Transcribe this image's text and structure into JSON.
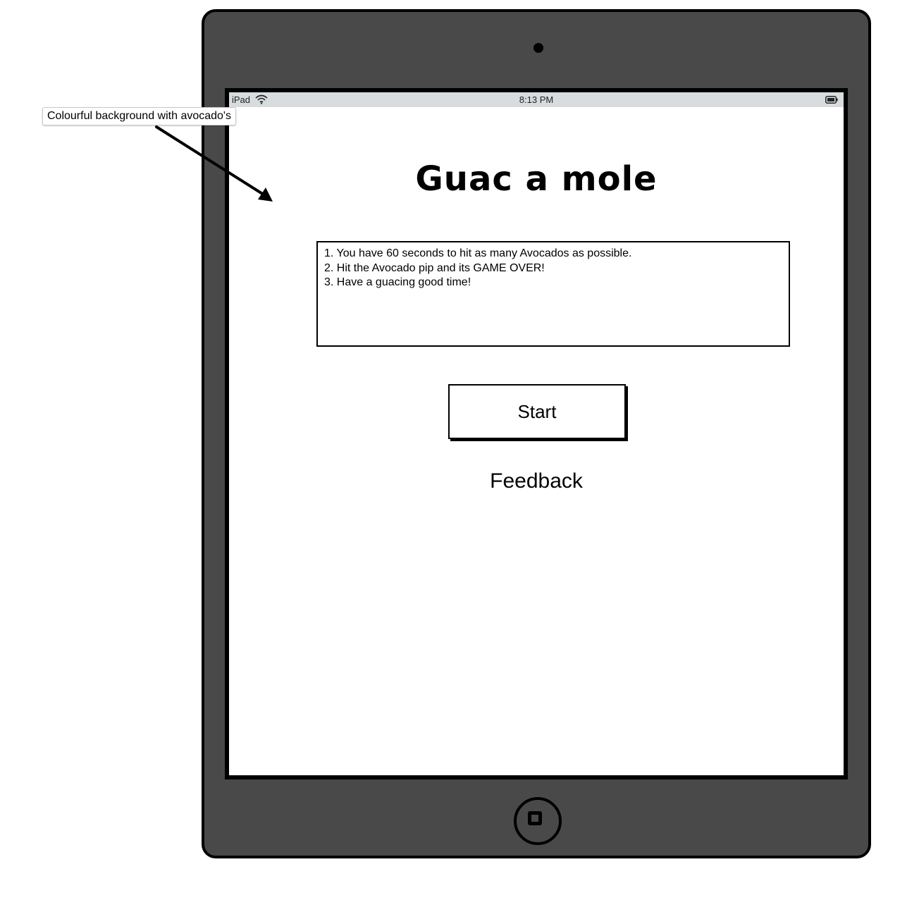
{
  "status_bar": {
    "device": "iPad",
    "time": "8:13 PM",
    "icons": [
      "wifi-icon",
      "battery-icon"
    ]
  },
  "app": {
    "title": "Guac a mole",
    "instructions": [
      "1. You have 60 seconds to hit as many Avocados as possible.",
      "2. Hit the Avocado pip and its GAME OVER!",
      "3. Have a guacing good time!"
    ],
    "start_label": "Start",
    "feedback_label": "Feedback"
  },
  "annotation": {
    "note": "Colourful background with avocado's"
  },
  "colors": {
    "device_body": "#494949",
    "status_bar": "#d7dcdf",
    "screen": "#ffffff"
  }
}
